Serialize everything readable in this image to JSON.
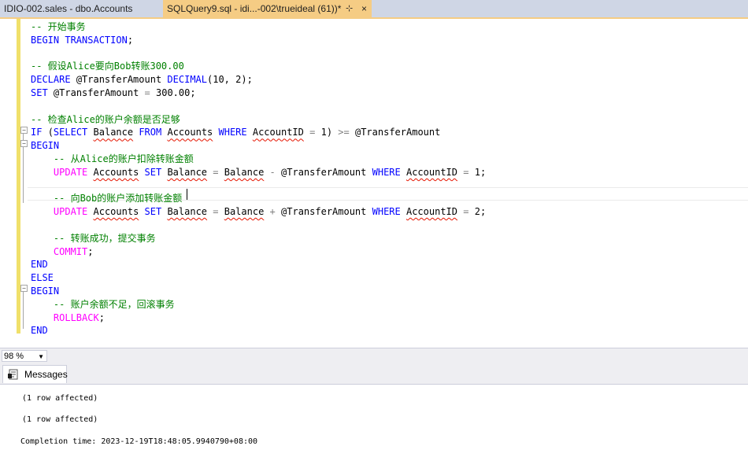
{
  "tabs": [
    {
      "label": "IDIO-002.sales - dbo.Accounts"
    },
    {
      "label": "SQLQuery9.sql - idi...-002\\trueideal (61))*",
      "pin": "⊹",
      "close": "×"
    }
  ],
  "code": {
    "lines": [
      [
        "-- 开始事务"
      ],
      [
        "BEGIN TRANSACTION;"
      ],
      [
        ""
      ],
      [
        "-- 假设Alice要向Bob转账300.00"
      ],
      [
        "DECLARE @TransferAmount DECIMAL(10, 2);"
      ],
      [
        "SET @TransferAmount = 300.00;"
      ],
      [
        ""
      ],
      [
        "-- 检查Alice的账户余额是否足够"
      ],
      [
        "IF (SELECT Balance FROM Accounts WHERE AccountID = 1) >= @TransferAmount"
      ],
      [
        "BEGIN"
      ],
      [
        "    -- 从Alice的账户扣除转账金额"
      ],
      [
        "    UPDATE Accounts SET Balance = Balance - @TransferAmount WHERE AccountID = 1;"
      ],
      [
        ""
      ],
      [
        "    -- 向Bob的账户添加转账金额"
      ],
      [
        "    UPDATE Accounts SET Balance = Balance + @TransferAmount WHERE AccountID = 2;"
      ],
      [
        ""
      ],
      [
        "    -- 转账成功，提交事务"
      ],
      [
        "    COMMIT;"
      ],
      [
        "END"
      ],
      [
        "ELSE"
      ],
      [
        "BEGIN"
      ],
      [
        "    -- 账户余额不足，回滚事务"
      ],
      [
        "    ROLLBACK;"
      ],
      [
        "END"
      ]
    ]
  },
  "zoom": {
    "value": "98 %"
  },
  "results": {
    "tab_label": "Messages"
  },
  "messages": [
    "(1 row affected)",
    "(1 row affected)",
    "Completion time: 2023-12-19T18:48:05.9940790+08:00"
  ]
}
